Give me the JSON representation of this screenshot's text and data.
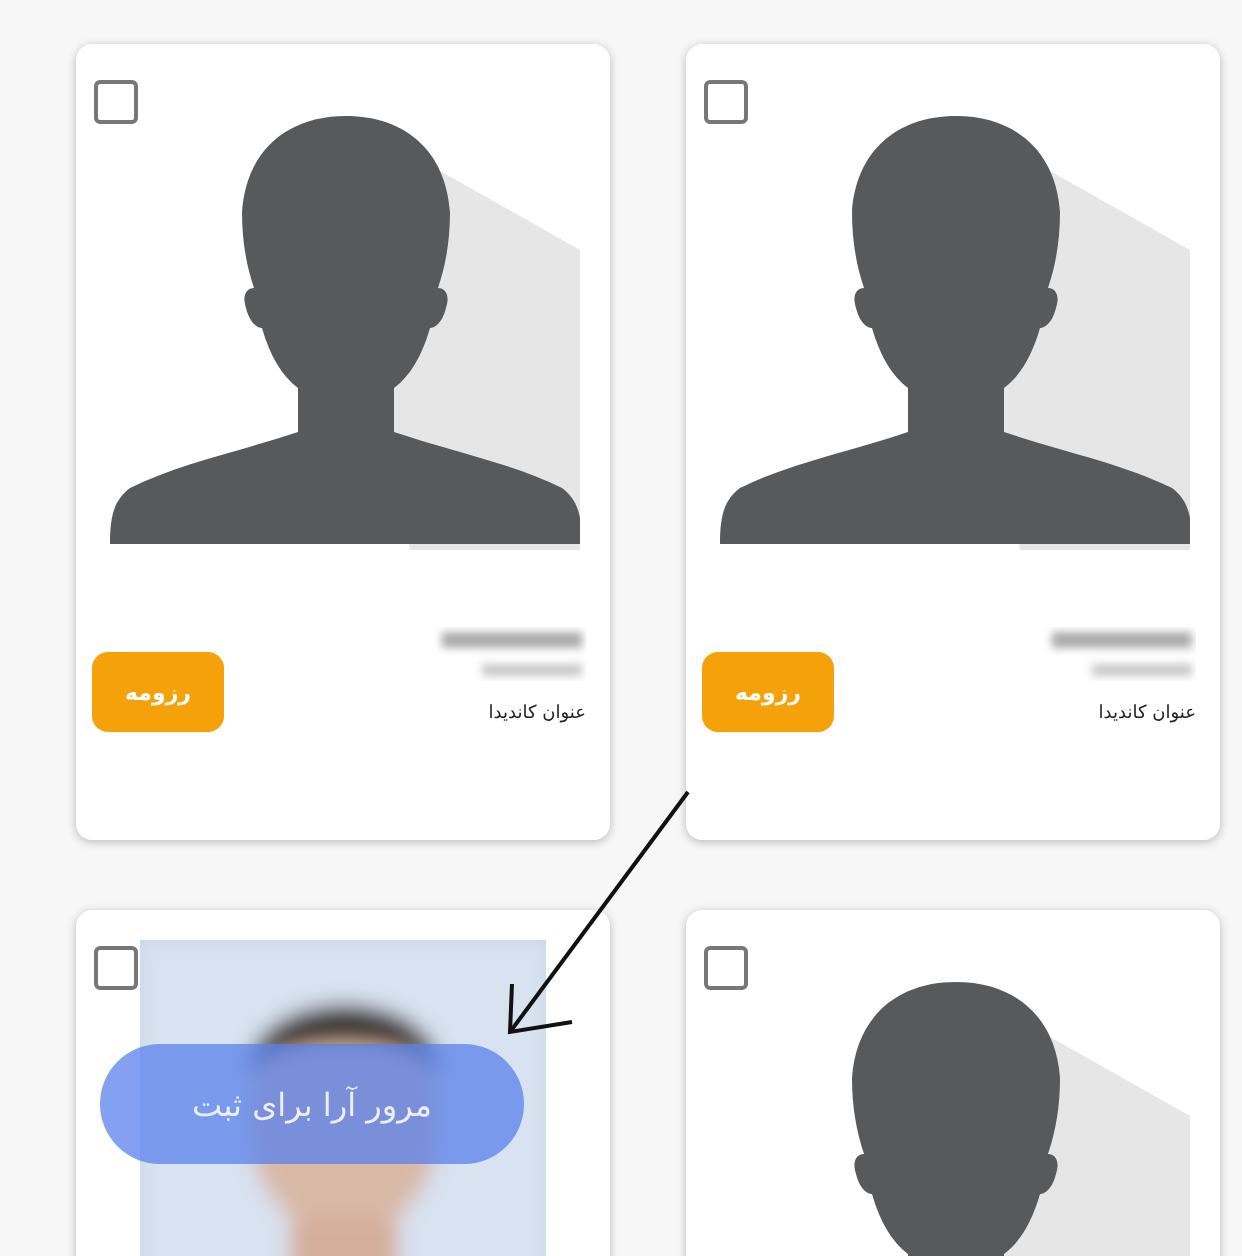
{
  "cards": [
    {
      "kind": "avatar",
      "checked": false,
      "title": "عنوان کاندیدا",
      "button": "رزومه"
    },
    {
      "kind": "avatar",
      "checked": false,
      "title": "عنوان کاندیدا",
      "button": "رزومه"
    },
    {
      "kind": "avatar",
      "checked": false
    },
    {
      "checked": false,
      "overlay": "مرور آرا برای ثبت"
    }
  ]
}
